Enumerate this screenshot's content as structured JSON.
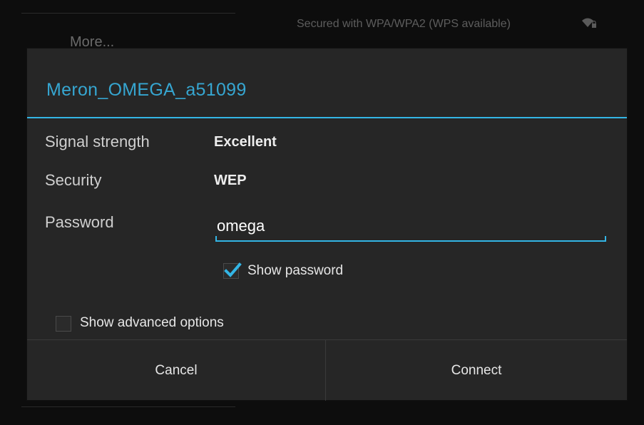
{
  "background": {
    "more_label": "More...",
    "network_security_text": "Secured with WPA/WPA2 (WPS available)",
    "wifi_icon": "wifi-lock-icon"
  },
  "dialog": {
    "title": "Meron_OMEGA_a51099",
    "signal_strength_label": "Signal strength",
    "signal_strength_value": "Excellent",
    "security_label": "Security",
    "security_value": "WEP",
    "password_label": "Password",
    "password_value": "omega",
    "show_password_label": "Show password",
    "show_password_checked": true,
    "show_advanced_label": "Show advanced options",
    "show_advanced_checked": false,
    "cancel_label": "Cancel",
    "connect_label": "Connect"
  },
  "colors": {
    "accent": "#33b5e5",
    "title": "#36a6d1",
    "dialog_bg": "#262626"
  }
}
